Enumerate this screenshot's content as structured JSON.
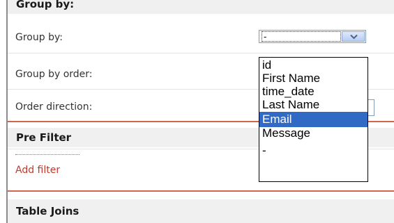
{
  "sections": {
    "group_by": {
      "title": "Group by:",
      "rows": {
        "group_by_label": "Group by:",
        "group_by_order_label": "Group by order:",
        "order_direction_label": "Order direction:"
      },
      "select": {
        "value": "-",
        "options": [
          "id",
          "First Name",
          "time_date",
          "Last Name",
          "Email",
          "Message",
          "-"
        ],
        "highlighted": "Email"
      }
    },
    "pre_filter": {
      "title": "Pre Filter",
      "add_filter_link": "Add filter"
    },
    "table_joins": {
      "title": "Table Joins"
    }
  },
  "colors": {
    "accent_line": "#d2654a",
    "link": "#c0392b",
    "selection": "#316ac5"
  },
  "icons": {
    "select_arrow": "chevron-down-icon"
  }
}
